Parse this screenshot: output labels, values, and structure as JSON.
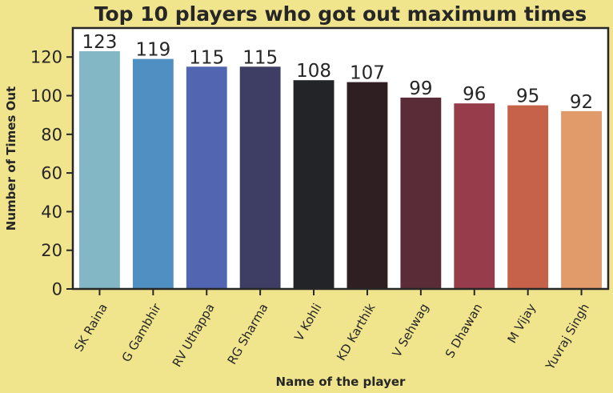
{
  "chart_data": {
    "type": "bar",
    "title": "Top 10 players who got out maximum times",
    "xlabel": "Name of the player",
    "ylabel": "Number of Times Out",
    "categories": [
      "SK Raina",
      "G Gambhir",
      "RV Uthappa",
      "RG Sharma",
      "V Kohli",
      "KD Karthik",
      "V Sehwag",
      "S Dhawan",
      "M Vijay",
      "Yuvraj Singh"
    ],
    "values": [
      123,
      119,
      115,
      115,
      108,
      107,
      99,
      96,
      95,
      92
    ],
    "data_labels": [
      "123",
      "119",
      "115",
      "115",
      "108",
      "107",
      "99",
      "96",
      "95",
      "92"
    ],
    "yticks": [
      0,
      20,
      40,
      60,
      80,
      100,
      120
    ],
    "ylim": [
      0,
      135
    ],
    "grid": false,
    "colors": [
      "#84b7c6",
      "#4f8fc2",
      "#5265b0",
      "#3e3d63",
      "#232428",
      "#2f1f22",
      "#5a2c38",
      "#973c4a",
      "#c6624a",
      "#e19a69"
    ],
    "background": "#f0e48d",
    "plot_background": "#ffffff"
  }
}
